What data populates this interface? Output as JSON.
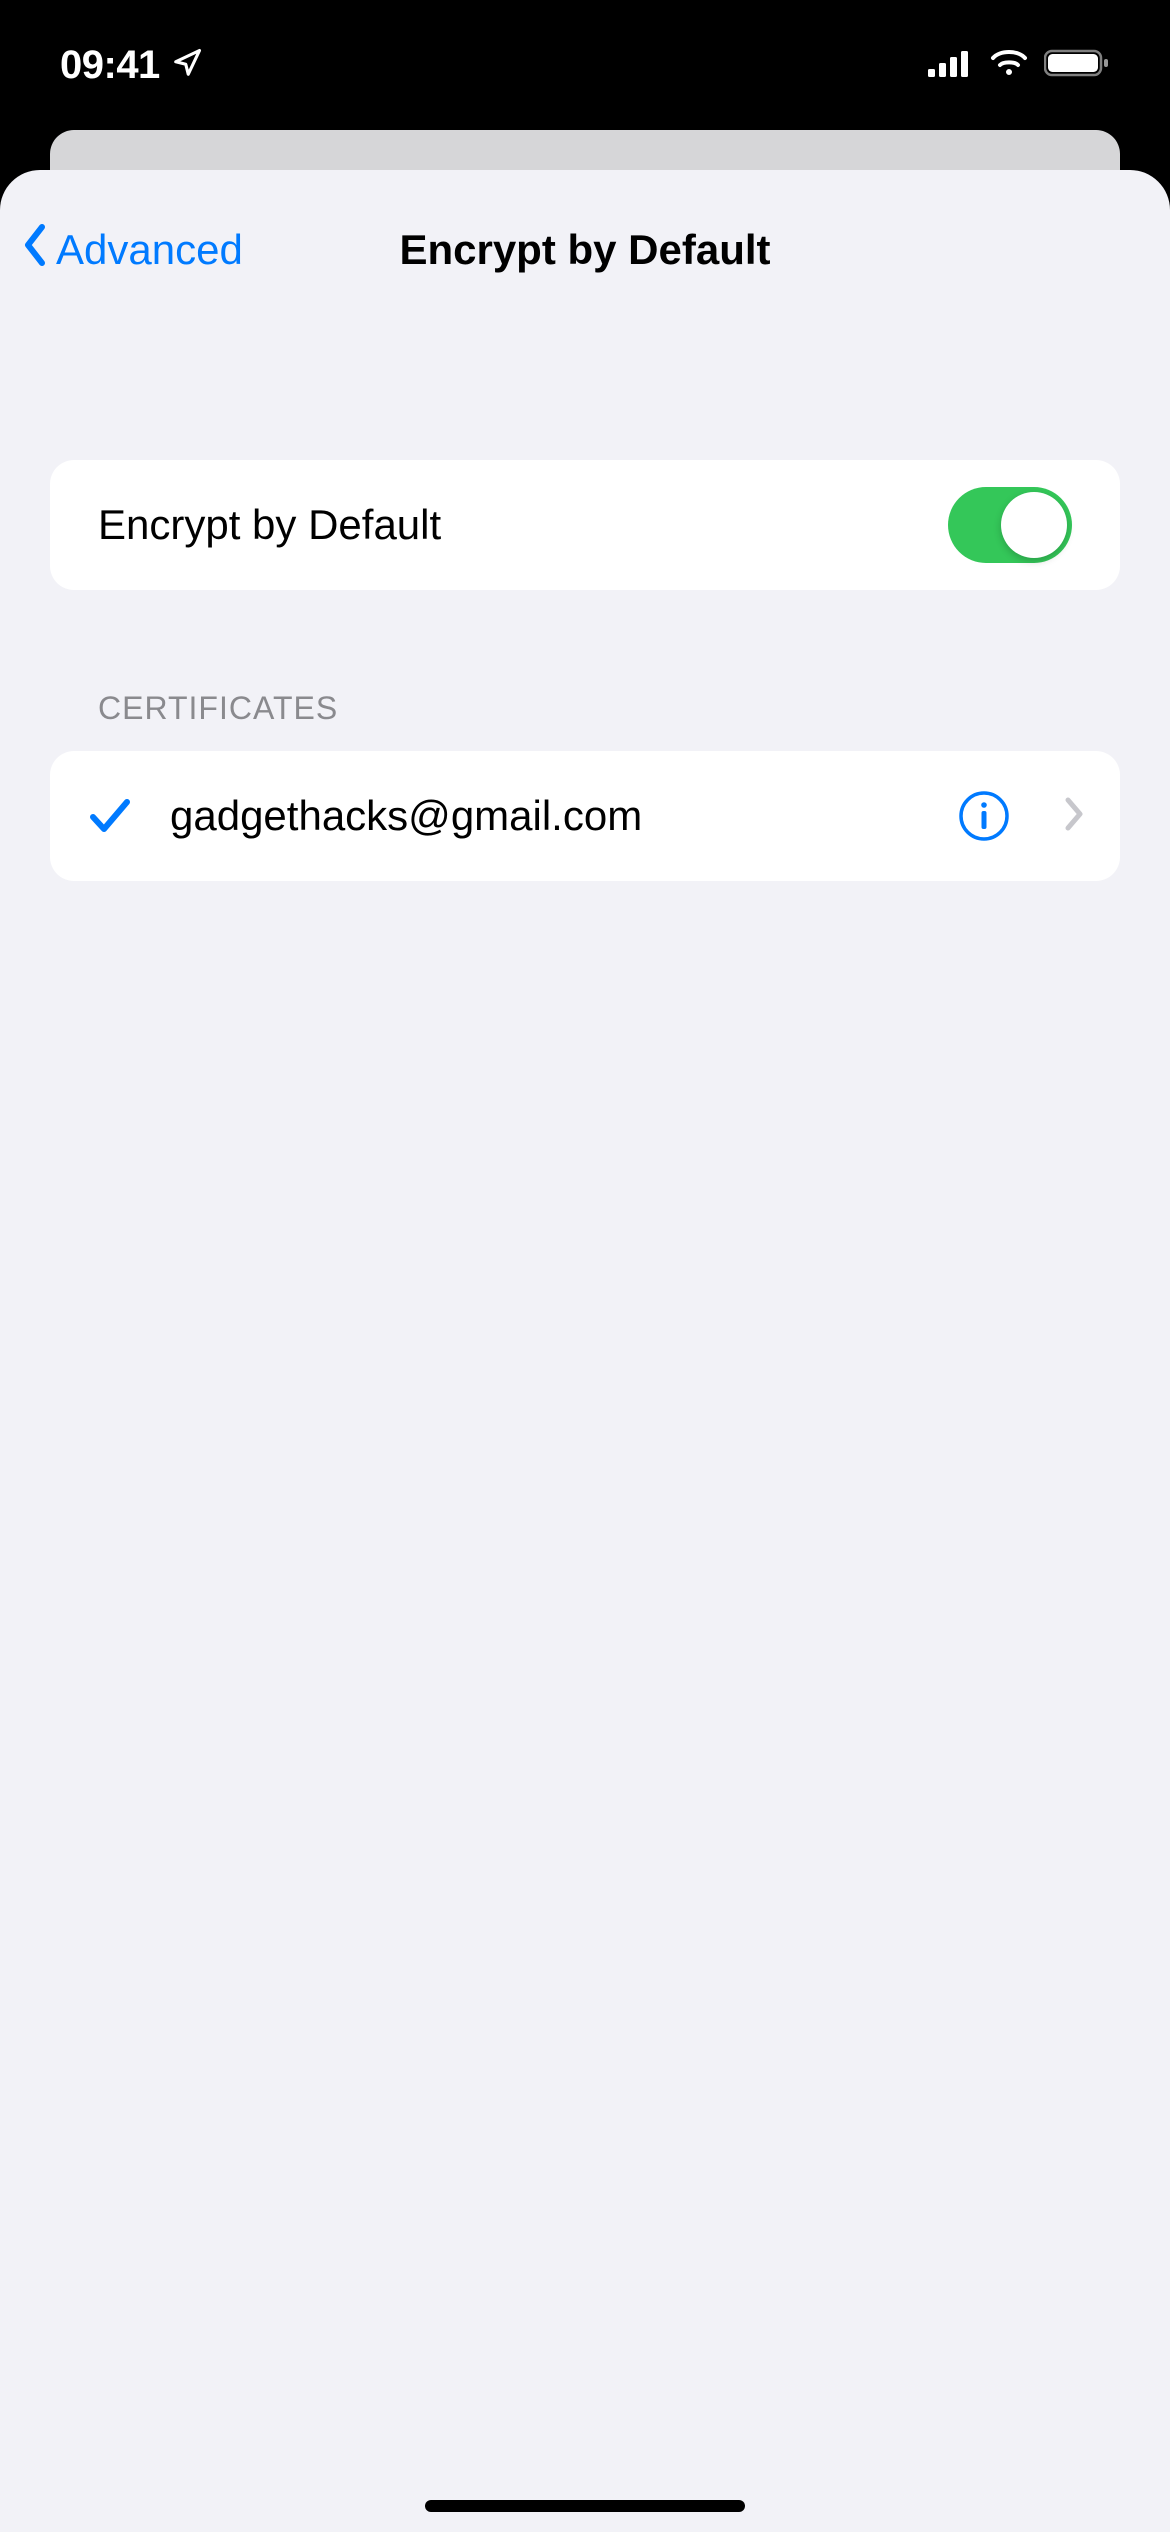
{
  "status": {
    "time": "09:41"
  },
  "nav": {
    "back_label": "Advanced",
    "title": "Encrypt by Default"
  },
  "main": {
    "encrypt_label": "Encrypt by Default",
    "encrypt_enabled": true
  },
  "certificates": {
    "header": "CERTIFICATES",
    "items": [
      {
        "email": "gadgethacks@gmail.com",
        "selected": true
      }
    ]
  }
}
